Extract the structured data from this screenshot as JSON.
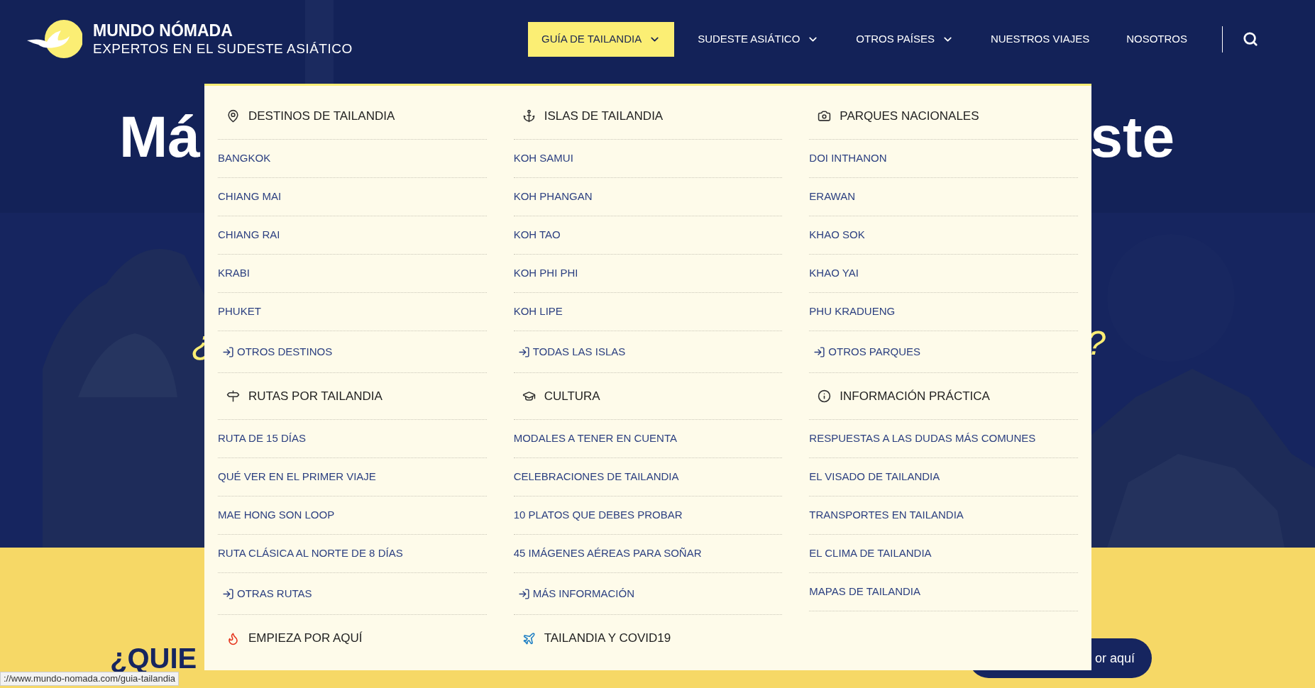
{
  "header": {
    "logo_title": "MUNDO NÓMADA",
    "logo_subtitle": "EXPERTOS EN EL SUDESTE ASIÁTICO",
    "nav": [
      {
        "label": "GUÍA DE TAILANDIA",
        "has_menu": true,
        "selected": true
      },
      {
        "label": "SUDESTE ASIÁTICO",
        "has_menu": true,
        "selected": false
      },
      {
        "label": "OTROS PAÍSES",
        "has_menu": true,
        "selected": false
      },
      {
        "label": "NUESTROS VIAJES",
        "has_menu": false,
        "selected": false
      },
      {
        "label": "NOSOTROS",
        "has_menu": false,
        "selected": false
      }
    ]
  },
  "hero": {
    "title_left": "Má",
    "title_right": "ste",
    "question_open": "¿",
    "question_close": "?"
  },
  "mega_menu": {
    "sections": [
      {
        "title": "DESTINOS DE TAILANDIA",
        "items": [
          {
            "label": "BANGKOK",
            "kind": "link"
          },
          {
            "label": "CHIANG MAI",
            "kind": "link"
          },
          {
            "label": "CHIANG RAI",
            "kind": "link"
          },
          {
            "label": "KRABI",
            "kind": "link"
          },
          {
            "label": "PHUKET",
            "kind": "link"
          },
          {
            "label": "OTROS DESTINOS",
            "kind": "more"
          }
        ]
      },
      {
        "title": "ISLAS DE TAILANDIA",
        "items": [
          {
            "label": "KOH SAMUI",
            "kind": "link"
          },
          {
            "label": "KOH PHANGAN",
            "kind": "link"
          },
          {
            "label": "KOH TAO",
            "kind": "link"
          },
          {
            "label": "KOH PHI PHI",
            "kind": "link"
          },
          {
            "label": "KOH LIPE",
            "kind": "link"
          },
          {
            "label": "TODAS LAS ISLAS",
            "kind": "more"
          }
        ]
      },
      {
        "title": "PARQUES NACIONALES",
        "items": [
          {
            "label": "DOI INTHANON",
            "kind": "link"
          },
          {
            "label": "ERAWAN",
            "kind": "link"
          },
          {
            "label": "KHAO SOK",
            "kind": "link"
          },
          {
            "label": "KHAO YAI",
            "kind": "link"
          },
          {
            "label": "PHU KRADUENG",
            "kind": "link"
          },
          {
            "label": "OTROS PARQUES",
            "kind": "more"
          }
        ]
      },
      {
        "title": "RUTAS POR TAILANDIA",
        "items": [
          {
            "label": "RUTA DE 15 DÍAS",
            "kind": "link"
          },
          {
            "label": "QUÉ VER EN EL PRIMER VIAJE",
            "kind": "link"
          },
          {
            "label": "MAE HONG SON LOOP",
            "kind": "link"
          },
          {
            "label": "RUTA CLÁSICA AL NORTE DE 8 DÍAS",
            "kind": "link"
          },
          {
            "label": "OTRAS RUTAS",
            "kind": "more"
          }
        ]
      },
      {
        "title": "CULTURA",
        "items": [
          {
            "label": "MODALES A TENER EN CUENTA",
            "kind": "link"
          },
          {
            "label": "CELEBRACIONES DE TAILANDIA",
            "kind": "link"
          },
          {
            "label": "10 PLATOS QUE DEBES PROBAR",
            "kind": "link"
          },
          {
            "label": "45 IMÁGENES AÉREAS PARA SOÑAR",
            "kind": "link"
          },
          {
            "label": "MÁS INFORMACIÓN",
            "kind": "more"
          }
        ]
      },
      {
        "title": "INFORMACIÓN PRÁCTICA",
        "items": [
          {
            "label": "RESPUESTAS A LAS DUDAS MÁS COMUNES",
            "kind": "link"
          },
          {
            "label": "EL VISADO DE TAILANDIA",
            "kind": "link"
          },
          {
            "label": "TRANSPORTES EN TAILANDIA",
            "kind": "link"
          },
          {
            "label": "EL CLIMA DE TAILANDIA",
            "kind": "link"
          },
          {
            "label": "MAPAS DE TAILANDIA",
            "kind": "link"
          }
        ]
      },
      {
        "title": "EMPIEZA POR AQUÍ"
      },
      {
        "title": "TAILANDIA Y COVID19"
      }
    ]
  },
  "section": {
    "heading": "¿QUIE",
    "button": "or aquí"
  },
  "status_bar": "://www.mundo-nomada.com/guia-tailandia"
}
